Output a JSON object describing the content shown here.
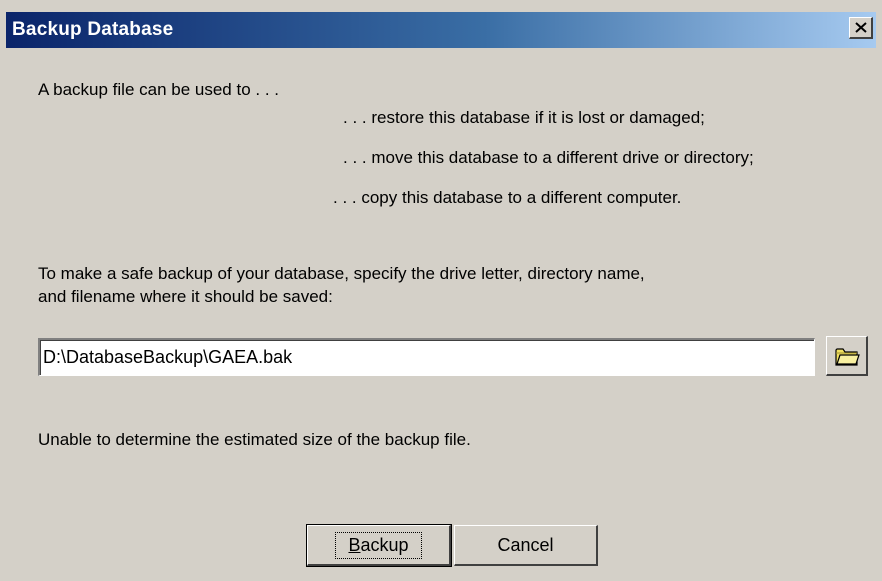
{
  "window": {
    "title": "Backup Database"
  },
  "intro": {
    "lead": "A backup file can be used to . . .",
    "uses": [
      ". . . restore this database if it is lost or damaged;",
      ". . . move this database to a different drive or directory;",
      ". . . copy this database to a different computer."
    ]
  },
  "instructions": {
    "line1": "To make a safe backup of your database, specify the drive letter, directory name,",
    "line2": "and filename where it should be saved:"
  },
  "path_field": {
    "value": "D:\\DatabaseBackup\\GAEA.bak"
  },
  "status": {
    "size_message": "Unable to determine the estimated size of the backup file."
  },
  "buttons": {
    "backup_mnemonic": "B",
    "backup_rest": "ackup",
    "cancel": "Cancel"
  },
  "icons": {
    "close": "close-icon",
    "browse": "folder-icon"
  },
  "colors": {
    "titlebar_start": "#0a246a",
    "titlebar_end": "#a6caf0",
    "dialog_bg": "#d4d0c8",
    "folder_yellow": "#f0e060"
  }
}
